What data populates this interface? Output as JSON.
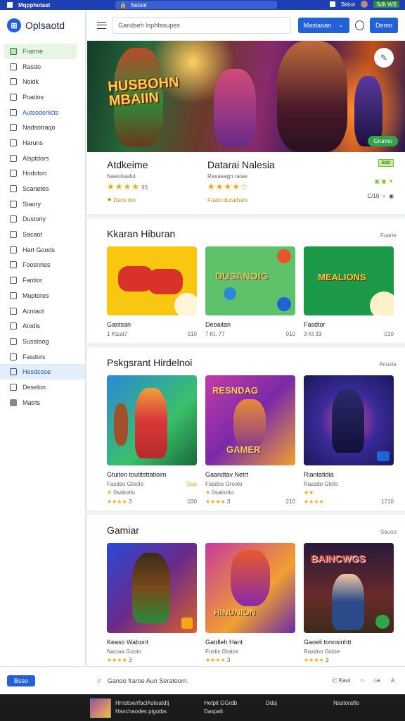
{
  "browser": {
    "app": "Mqpphotast",
    "url": "Setsot",
    "right_a": "Skbot",
    "right_b": "Sdlt",
    "right_c": "WS"
  },
  "sidebar": {
    "logo": "Oplsaotd",
    "items": [
      {
        "label": "Frarme"
      },
      {
        "label": "Rasdo"
      },
      {
        "label": "Noidk"
      },
      {
        "label": "Poatios"
      },
      {
        "label": "Autsoderlicts"
      },
      {
        "label": "Nadsotraqo"
      },
      {
        "label": "Haruns"
      },
      {
        "label": "Alsptdors"
      },
      {
        "label": "Hodoton"
      },
      {
        "label": "Scanetes"
      },
      {
        "label": "Staory"
      },
      {
        "label": "Dustoriy"
      },
      {
        "label": "Sacaot"
      },
      {
        "label": "Hart Goods"
      },
      {
        "label": "Foosnnes"
      },
      {
        "label": "Fantior"
      },
      {
        "label": "Muptores"
      },
      {
        "label": "Acntaot"
      },
      {
        "label": "Atodis"
      },
      {
        "label": "Susstoog"
      },
      {
        "label": "Fasdors"
      },
      {
        "label": "Hesdcose"
      },
      {
        "label": "Deselon"
      },
      {
        "label": "Matrts"
      }
    ]
  },
  "header": {
    "search_placeholder": "Gandseh lnphfasupes",
    "primary_btn": "Mastaoan",
    "primary_caret": "⌄",
    "secondary_btn": "Demo"
  },
  "hero": {
    "title_line1": "HUSBOHN",
    "title_line2": "MBAIIN",
    "cta": "Grunno"
  },
  "info": {
    "left": {
      "title": "Atdkeime",
      "sub": "Naeoriaalut",
      "rating": "95",
      "link": "⚑ Dsco ten"
    },
    "mid": {
      "title": "Datarai Nalesia",
      "sub": "Rasaeagn ratae",
      "link": "Fusto ducathars"
    },
    "right": {
      "tag": "Bab",
      "time": "C/10"
    }
  },
  "sections": [
    {
      "title": "Kkaran Hiburan",
      "more": "Fuarte",
      "cards": [
        {
          "name": "Gantsan",
          "meta": "1 Ktsat7",
          "count": "010"
        },
        {
          "name": "Deoaitan",
          "meta": "7 Kt. 77",
          "count": "010"
        },
        {
          "name": "Fasdtor",
          "meta": "3 Kt 33",
          "count": "010"
        }
      ]
    },
    {
      "title": "Pskgsrant Hirdelnoi",
      "more": "Anusta",
      "cards": [
        {
          "name": "Gtuiton toutitsttatioim",
          "meta": "Fasdso Gteolo",
          "extra": "0sabotto",
          "count": "030",
          "badge": "Sau"
        },
        {
          "name": "Gaandtav Netrt",
          "meta": "Fasdso Groolo",
          "extra": "0sabotto",
          "count": "210",
          "badge": ""
        },
        {
          "name": "Riantatidia",
          "meta": "Rassdo Gtolo",
          "extra": "",
          "count": "1710",
          "badge": ""
        }
      ]
    },
    {
      "title": "Gamiar",
      "more": "Sauoo",
      "cards": [
        {
          "name": "Keaso Wabont",
          "meta": "Naciaa Gooto",
          "count": ""
        },
        {
          "name": "Gatdleh Hant",
          "meta": "Fustis Gtatos",
          "count": ""
        },
        {
          "name": "Gaoeli tonnsinhtt",
          "meta": "Rasdno Gidoe",
          "count": ""
        }
      ]
    }
  ],
  "bottombar": {
    "home": "Bsso",
    "search": "Ganoo fraroe Aun Seratoorn.",
    "b1": "Kaut"
  },
  "taskbar": {
    "t1": "Hrnstoe/rfaclAsteatdtj",
    "t2": "Hanchaodes pigutbs",
    "t3": "Hetpit GGrdb",
    "t4": "Daspalt",
    "t5": "Ddsj",
    "t6": "Nastorafte"
  }
}
